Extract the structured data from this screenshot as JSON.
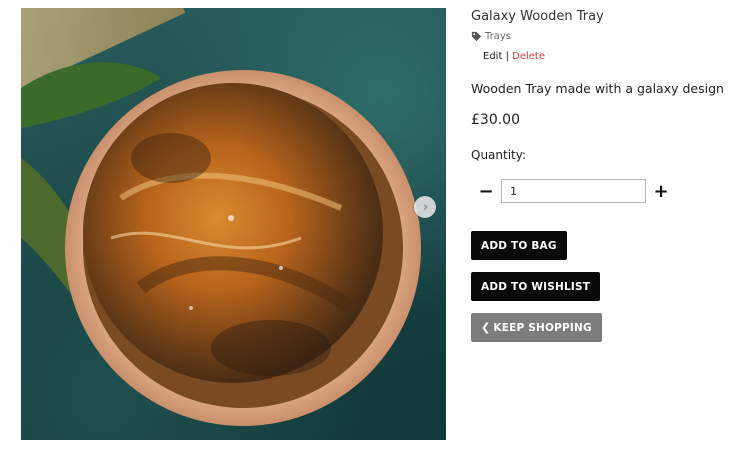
{
  "product": {
    "title": "Galaxy Wooden Tray",
    "category": "Trays",
    "edit_label": "Edit",
    "separator": "|",
    "delete_label": "Delete",
    "description": "Wooden Tray made with a galaxy design",
    "price": "£30.00",
    "quantity_label": "Quantity:",
    "quantity_value": "1",
    "decrement_label": "−",
    "increment_label": "+"
  },
  "buttons": {
    "add_to_bag": "ADD TO BAG",
    "add_to_wishlist": "ADD TO WISHLIST",
    "keep_shopping": "KEEP SHOPPING"
  },
  "icons": {
    "category": "tag-icon",
    "carousel_next": "chevron-right-icon",
    "keep_shopping": "chevron-left-icon"
  },
  "colors": {
    "delete_link": "#e0413b",
    "primary_button": "#0a0a0a",
    "secondary_button": "#7d7d7d"
  }
}
